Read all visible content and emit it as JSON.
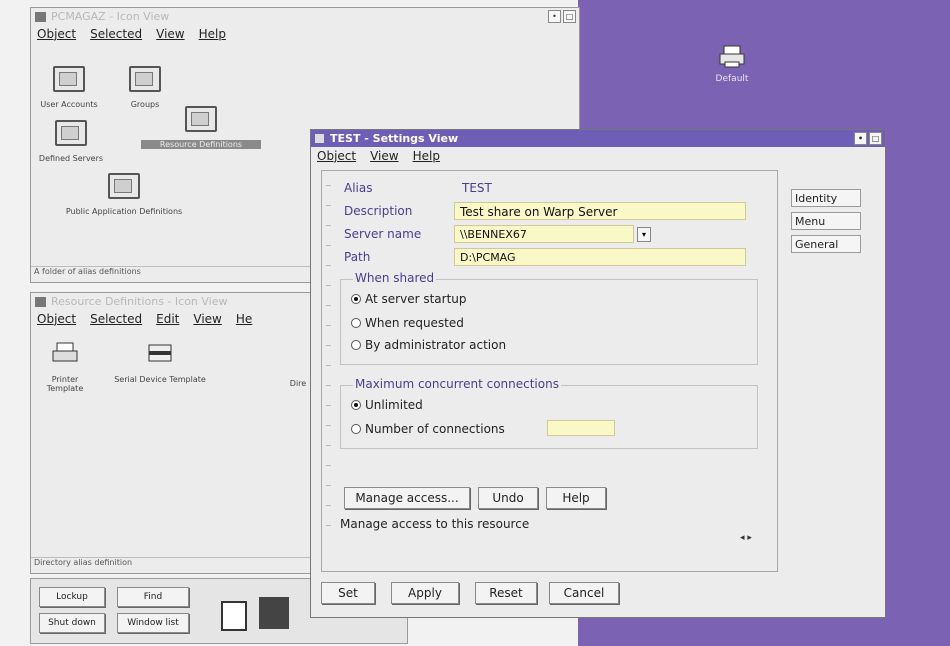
{
  "desktop": {
    "icon_label": "Default"
  },
  "pcmag_window": {
    "title": "PCMAGAZ - Icon View",
    "menu": [
      "Object",
      "Selected",
      "View",
      "Help"
    ],
    "icons": [
      "User Accounts",
      "Groups",
      "Defined Servers",
      "Resource Definitions",
      "Public Application Definitions"
    ],
    "status": "A folder of alias definitions"
  },
  "resource_window": {
    "title": "Resource Definitions - Icon View",
    "menu": [
      "Object",
      "Selected",
      "Edit",
      "View",
      "He"
    ],
    "icons": [
      "Printer Template",
      "Serial Device Template",
      "Dire"
    ],
    "status": "Directory alias definition"
  },
  "launchpad": {
    "buttons": [
      "Lockup",
      "Find",
      "Shut down",
      "Window list"
    ]
  },
  "settings": {
    "title": "TEST - Settings View",
    "menu": [
      "Object",
      "View",
      "Help"
    ],
    "alias_label": "Alias",
    "alias_value": "TEST",
    "description_label": "Description",
    "description_value": "Test share on Warp Server",
    "server_label": "Server name",
    "server_value": "\\\\BENNEX67",
    "path_label": "Path",
    "path_value": "D:\\PCMAG",
    "when_shared_title": "When shared",
    "when_shared_options": [
      "At server startup",
      "When requested",
      "By administrator action"
    ],
    "max_conn_title": "Maximum concurrent connections",
    "max_conn_options": [
      "Unlimited",
      "Number of connections"
    ],
    "buttons": {
      "manage": "Manage access...",
      "undo": "Undo",
      "help": "Help"
    },
    "status": "Manage access to this resource",
    "tabs": [
      "Identity",
      "Menu",
      "General"
    ],
    "bottom_buttons": {
      "set": "Set",
      "apply": "Apply",
      "reset": "Reset",
      "cancel": "Cancel"
    },
    "colors": {
      "titlebar": "#6f5eb6",
      "field_bg": "#fbf8c8",
      "label": "#4b3c90",
      "desktop": "#7b62b3"
    }
  }
}
